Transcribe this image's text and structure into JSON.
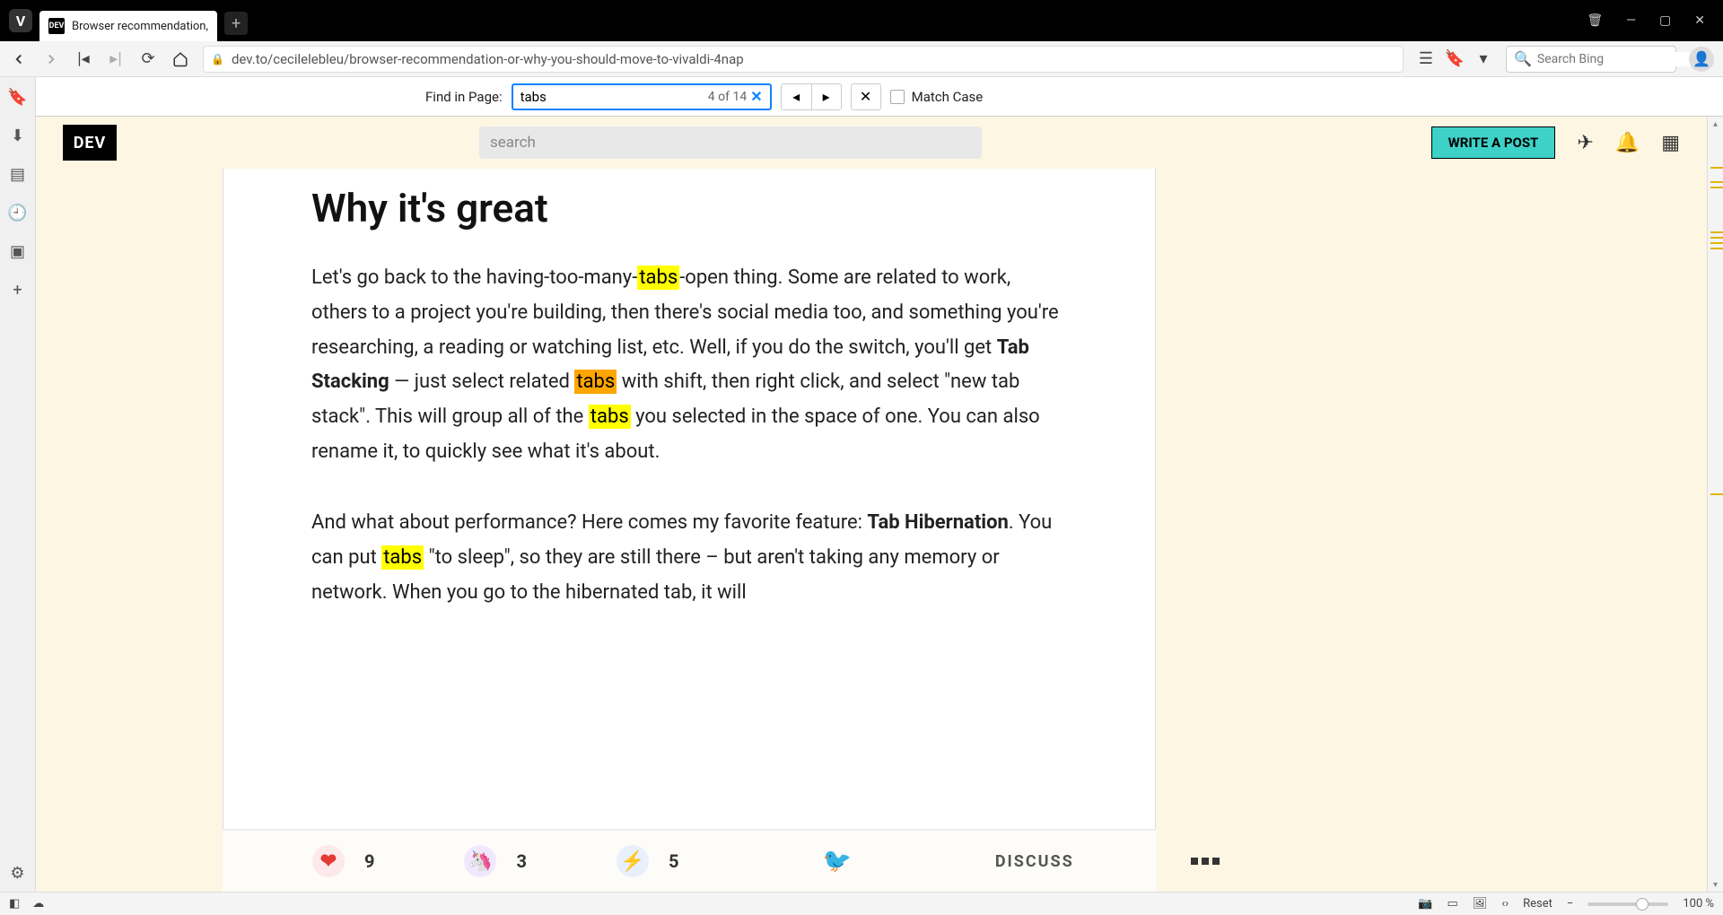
{
  "window": {
    "tab_title": "Browser recommendation,",
    "tab_badge": "DEV"
  },
  "nav": {
    "url": "dev.to/cecilelebleu/browser-recommendation-or-why-you-should-move-to-vivaldi-4nap",
    "search_placeholder": "Search Bing"
  },
  "findbar": {
    "label": "Find in Page:",
    "value": "tabs",
    "count": "4 of 14",
    "match_case": "Match Case"
  },
  "devheader": {
    "logo": "DEV",
    "search_placeholder": "search",
    "write_post": "WRITE A POST"
  },
  "article": {
    "heading": "Why it's great",
    "p1_pre": "Let's go back to the having-too-many-",
    "p1_hl1": "tabs",
    "p1_mid1": "-open thing. Some are related to work, others to a project you're building, then there's social media too, and something you're researching, a reading or watching list, etc. Well, if you do the switch, you'll get ",
    "p1_bold1": "Tab Stacking",
    "p1_mid2": " — just select related ",
    "p1_hl2": "tabs",
    "p1_mid3": " with shift, then right click, and select \"new tab stack\". This will group all of the ",
    "p1_hl3": "tabs",
    "p1_post": " you selected in the space of one. You can also rename it, to quickly see what it's about.",
    "p2_pre": "And what about performance? Here comes my favorite feature: ",
    "p2_bold": "Tab Hibernation",
    "p2_mid1": ". You can put ",
    "p2_hl": "tabs",
    "p2_post": " \"to sleep\", so they are still there – but aren't taking any memory or network. When you go to the hibernated tab, it will"
  },
  "actions": {
    "hearts": "9",
    "unicorns": "3",
    "bolts": "5",
    "discuss": "DISCUSS"
  },
  "statusbar": {
    "reset": "Reset",
    "zoom": "100 %"
  }
}
